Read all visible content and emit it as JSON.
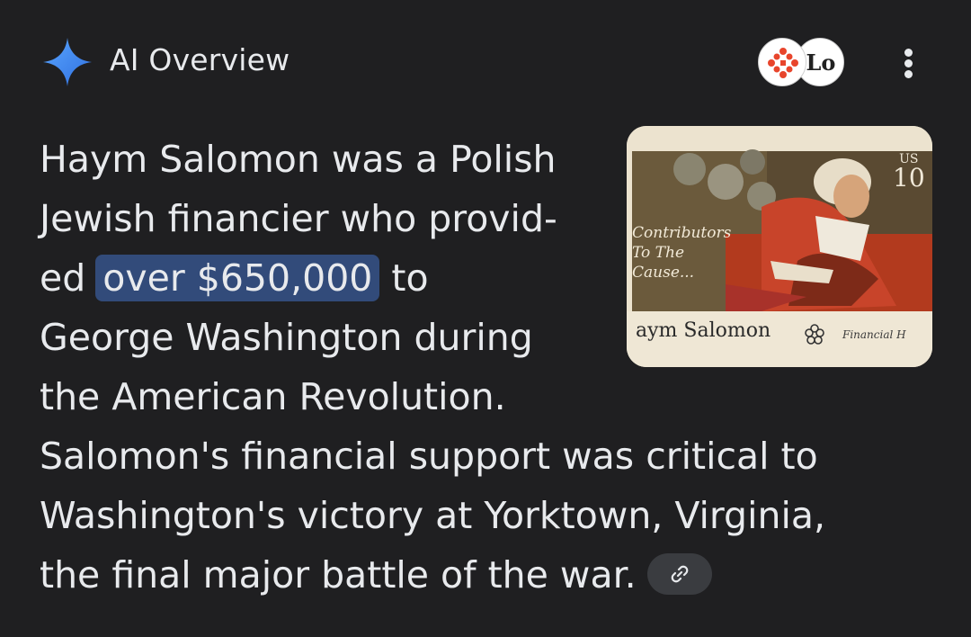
{
  "header": {
    "title": "AI Overview"
  },
  "source_badges": {
    "badge_b_text": "Lo"
  },
  "overview": {
    "lines": [
      {
        "text": "Haym Salomon was a Polish"
      },
      {
        "text": "Jewish financier who provid-"
      },
      {
        "pre": "ed ",
        "highlight": "over $650,000",
        "post": " to"
      },
      {
        "text": "George Washington during"
      },
      {
        "text": "the American Revolution."
      },
      {
        "text": "Salomon's financial support was critical to"
      },
      {
        "text": "Washington's victory at Yorktown, Virginia,"
      },
      {
        "text": "the final major battle of the war."
      }
    ]
  },
  "image": {
    "side_text": [
      "Contributors",
      "To The",
      "Cause..."
    ],
    "denomination_country": "US",
    "denomination_value": "10",
    "caption": "aym Salomon",
    "caption_right": "Financial H"
  },
  "icons": {
    "sparkle": "ai-sparkle-icon",
    "menu": "more-vert-icon",
    "link": "link-icon"
  },
  "colors": {
    "background": "#1f1f21",
    "text": "#e8eaed",
    "highlight": "#324b7a",
    "sparkle": "#4a8ef0",
    "chip": "#3a3c40"
  }
}
